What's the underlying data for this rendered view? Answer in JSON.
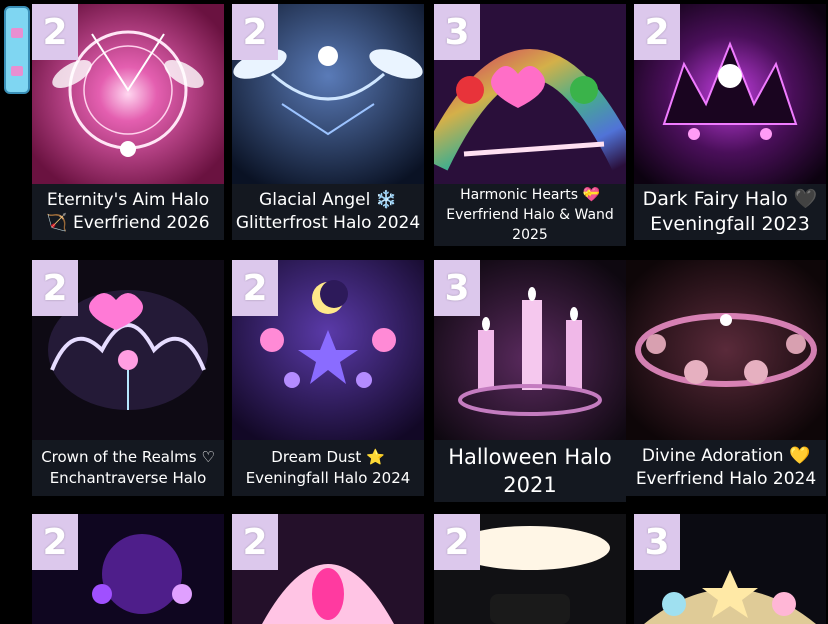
{
  "scroll_handle": {
    "icon": "scroll-grip"
  },
  "items": [
    {
      "badge": "2",
      "title_lines": [
        "Eternity's Aim Halo",
        "🏹 Everfriend 2026"
      ],
      "colors": [
        "#7a1a4e",
        "#f6a6d6"
      ],
      "art": "bow-wreath"
    },
    {
      "badge": "2",
      "title_lines": [
        "Glacial Angel ❄️",
        "Glitterfrost Halo 2024"
      ],
      "colors": [
        "#0d1a33",
        "#bcdcff"
      ],
      "art": "ice-wings"
    },
    {
      "badge": "3",
      "title_lines": [
        "Harmonic Hearts 💝",
        "Everfriend Halo & Wand",
        "2025"
      ],
      "colors": [
        "#2a0f3a",
        "#ff6ec7"
      ],
      "art": "heart-crown"
    },
    {
      "badge": "2",
      "title_lines": [
        "Dark Fairy Halo 🖤",
        "Eveningfall 2023"
      ],
      "colors": [
        "#120418",
        "#d35bf0"
      ],
      "art": "dark-crown"
    },
    {
      "badge": "2",
      "title_lines": [
        "Crown of the Realms ♡",
        "Enchantraverse Halo"
      ],
      "colors": [
        "#0e0a14",
        "#c9b7ff"
      ],
      "art": "realm-crown"
    },
    {
      "badge": "2",
      "title_lines": [
        "Dream Dust ⭐",
        "Eveningfall Halo 2024"
      ],
      "colors": [
        "#1a0c33",
        "#9a7cff"
      ],
      "art": "moon-stars"
    },
    {
      "badge": "3",
      "title_lines": [
        "Halloween Halo",
        "2021"
      ],
      "colors": [
        "#120a16",
        "#e4a6e0"
      ],
      "art": "candles"
    },
    {
      "badge": "",
      "title_lines": [
        "Divine Adoration 💛",
        "Everfriend Halo 2024"
      ],
      "colors": [
        "#140a10",
        "#ff9bd8"
      ],
      "art": "rose-wreath"
    },
    {
      "badge": "2",
      "title_lines": [],
      "colors": [
        "#0f0620",
        "#a050ff"
      ],
      "art": "night-garden"
    },
    {
      "badge": "2",
      "title_lines": [],
      "colors": [
        "#24102a",
        "#ffb0e0"
      ],
      "art": "shell"
    },
    {
      "badge": "2",
      "title_lines": [],
      "colors": [
        "#111114",
        "#fff6e6"
      ],
      "art": "light-ring"
    },
    {
      "badge": "3",
      "title_lines": [],
      "colors": [
        "#0b0b12",
        "#f6e0a6"
      ],
      "art": "star-flowers"
    }
  ]
}
